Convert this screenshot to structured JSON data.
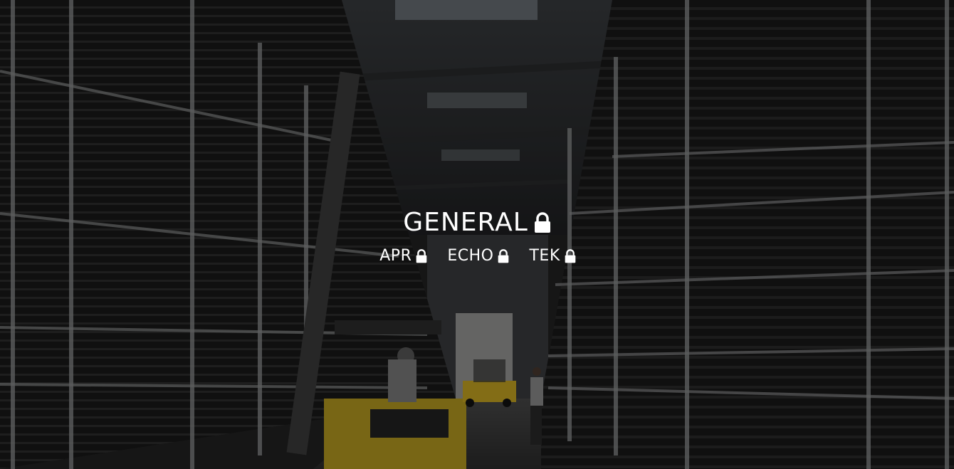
{
  "hero": {
    "background": "warehouse-photo",
    "overlay_color": "#000000"
  },
  "main_link": {
    "label": "GENERAL",
    "icon": "lock-icon"
  },
  "sub_links": [
    {
      "label": "APR",
      "icon": "lock-icon"
    },
    {
      "label": "ECHO",
      "icon": "lock-icon"
    },
    {
      "label": "TEK",
      "icon": "lock-icon"
    }
  ],
  "colors": {
    "text": "#ffffff",
    "forklift": "#d8b526"
  }
}
